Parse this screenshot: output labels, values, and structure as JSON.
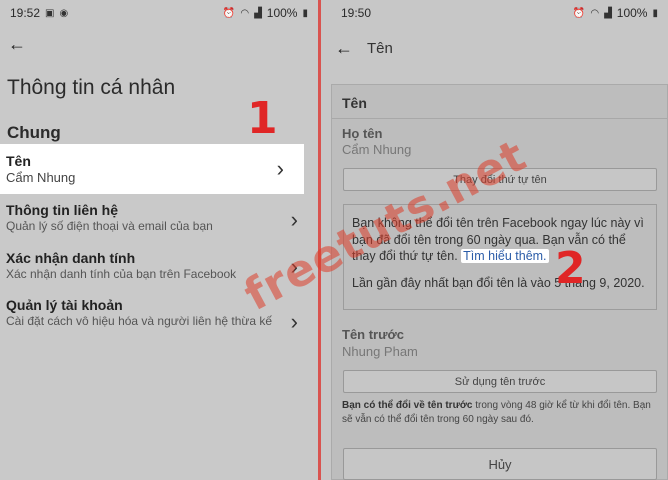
{
  "left": {
    "status": {
      "time": "19:52",
      "battery": "100%"
    },
    "back_icon": "back-arrow-icon",
    "title": "Thông tin cá nhân",
    "section": "Chung",
    "items": [
      {
        "label": "Tên",
        "sub": "Cẩm Nhung"
      },
      {
        "label": "Thông tin liên hệ",
        "sub": "Quản lý số điện thoại và email của bạn"
      },
      {
        "label": "Xác nhận danh tính",
        "sub": "Xác nhận danh tính của bạn trên Facebook"
      },
      {
        "label": "Quản lý tài khoản",
        "sub": "Cài đặt cách vô hiệu hóa và người liên hệ thừa kế"
      }
    ],
    "step_number": "1"
  },
  "right": {
    "status": {
      "time": "19:50",
      "battery": "100%"
    },
    "header_title": "Tên",
    "card_title": "Tên",
    "full_name_label": "Họ tên",
    "full_name_value": "Cẩm Nhung",
    "change_order_button": "Thay đổi thứ tự tên",
    "info_text_1": "Bạn không thể đổi tên trên Facebook ngay lúc này vì bạn đã đổi tên trong 60 ngày qua. Bạn vẫn có thể thay đổi thứ tự tên.",
    "learn_more": "Tìm hiểu thêm.",
    "info_text_2": "Lần gần đây nhất bạn đổi tên là vào 5 tháng 9, 2020.",
    "previous_name_label": "Tên trước",
    "previous_name_value": "Nhung Pham",
    "use_previous_button": "Sử dụng tên trước",
    "note_bold": "Bạn có thể đổi về tên trước",
    "note_rest": " trong vòng 48 giờ kể từ khi đổi tên. Bạn sẽ vẫn có thể đổi tên trong 60 ngày sau đó.",
    "cancel_button": "Hủy",
    "step_number": "2"
  },
  "watermark": "freetuts.net",
  "colors": {
    "accent_red": "#e02626",
    "highlight_bg": "#ffffff",
    "link": "#2b5ca8"
  }
}
